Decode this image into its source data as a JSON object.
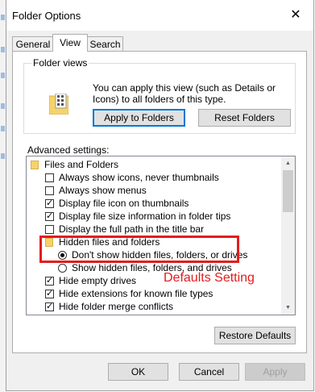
{
  "window": {
    "title": "Folder Options",
    "close_glyph": "✕"
  },
  "tabs": [
    {
      "label": "General",
      "active": false
    },
    {
      "label": "View",
      "active": true
    },
    {
      "label": "Search",
      "active": false
    }
  ],
  "folder_views": {
    "label": "Folder views",
    "description": "You can apply this view (such as Details or Icons) to all folders of this type.",
    "apply_button": "Apply to Folders",
    "reset_button": "Reset Folders"
  },
  "advanced": {
    "label": "Advanced settings:",
    "items": [
      {
        "kind": "folder",
        "label": "Files and Folders"
      },
      {
        "kind": "checkbox",
        "label": "Always show icons, never thumbnails",
        "checked": false
      },
      {
        "kind": "checkbox",
        "label": "Always show menus",
        "checked": false
      },
      {
        "kind": "checkbox",
        "label": "Display file icon on thumbnails",
        "checked": true
      },
      {
        "kind": "checkbox",
        "label": "Display file size information in folder tips",
        "checked": true
      },
      {
        "kind": "checkbox",
        "label": "Display the full path in the title bar",
        "checked": false
      },
      {
        "kind": "folder",
        "label": "Hidden files and folders"
      },
      {
        "kind": "radio",
        "label": "Don't show hidden files, folders, or drives",
        "checked": true
      },
      {
        "kind": "radio",
        "label": "Show hidden files, folders, and drives",
        "checked": false
      },
      {
        "kind": "checkbox",
        "label": "Hide empty drives",
        "checked": true
      },
      {
        "kind": "checkbox",
        "label": "Hide extensions for known file types",
        "checked": true
      },
      {
        "kind": "checkbox",
        "label": "Hide folder merge conflicts",
        "checked": true
      }
    ]
  },
  "annotation": {
    "text": "Defaults Setting",
    "color": "#e31c1c"
  },
  "buttons": {
    "restore_defaults": "Restore Defaults",
    "ok": "OK",
    "cancel": "Cancel",
    "apply": "Apply"
  },
  "colors": {
    "accent": "#0078d7",
    "dialog_bg": "#f0f0f0",
    "annotation": "#e31c1c"
  }
}
